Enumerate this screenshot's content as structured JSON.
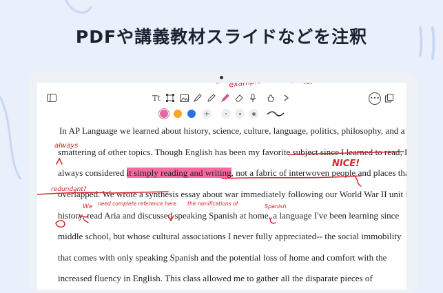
{
  "headline": "PDFや講義教材スライドなどを注釈",
  "toolbar": {
    "text_tool_icon": "text-tool-icon",
    "colors": [
      "#e06aa3",
      "#f6a524",
      "#2f6fe4"
    ]
  },
  "document": {
    "lines": [
      {
        "text": "In AP Language we learned about history, science, culture, language, politics, philosophy, and a"
      },
      {
        "text": "smattering of other topics. Though English has been my favorite subject since I learned to read, I"
      },
      {
        "pre": "always considered ",
        "highlight": "it simply reading and writing",
        "post": ", not a fabric of interwoven people and places that"
      },
      {
        "text": "overlapped. We wrote a synthesis essay about war immediately following our World War II unit in"
      },
      {
        "text": "history, read Aria and discussed speaking Spanish at home, a language I've been learning since"
      },
      {
        "text": "middle school, but whose cultural associations I never fully appreciated-- the social immobility"
      },
      {
        "text": "that comes with only speaking Spanish and the potential loss of home and comfort with the"
      },
      {
        "text": "increased fluency in English. This class allowed me to gather all the disparate pieces of"
      }
    ]
  },
  "annotations": {
    "always": "always",
    "nice": "NICE!",
    "redundant": "redundant?",
    "we": "We",
    "need_ref": "need complete reference here",
    "ramifications": "the ramifications of",
    "spanish": "Spanish",
    "examples": "examples",
    "top_right": "for"
  }
}
